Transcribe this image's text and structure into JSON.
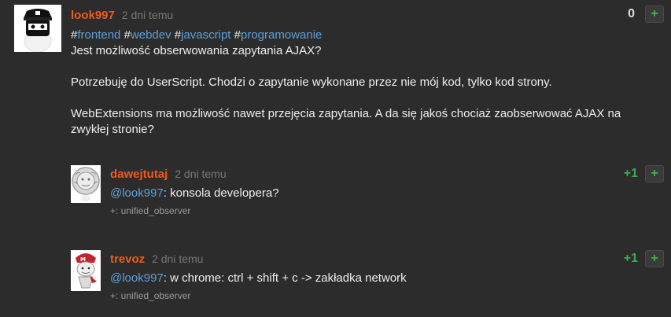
{
  "entry": {
    "author": "look997",
    "time": "2 dni temu",
    "votes": "0",
    "vote_button": "+",
    "tags": [
      {
        "hash": "#",
        "name": "frontend"
      },
      {
        "hash": "#",
        "name": "webdev"
      },
      {
        "hash": "#",
        "name": "javascript"
      },
      {
        "hash": "#",
        "name": "programowanie"
      }
    ],
    "paragraphs": [
      "Jest możliwość obserwowania zapytania AJAX?",
      "Potrzebuję do UserScript. Chodzi o zapytanie wykonane przez nie mój kod, tylko kod strony.",
      "WebExtensions ma możliwość nawet przejęcia zapytania. A da się jakoś chociaż zaobserwować AJAX na zwykłej stronie?"
    ]
  },
  "comments": [
    {
      "author": "dawejtutaj",
      "time": "2 dni temu",
      "votes": "+1",
      "vote_button": "+",
      "mention": "@look997",
      "text": ": konsola developera?",
      "meta": "+: unified_observer"
    },
    {
      "author": "trevoz",
      "time": "2 dni temu",
      "votes": "+1",
      "vote_button": "+",
      "mention": "@look997",
      "text": ": w chrome: ctrl + shift + c -> zakładka network",
      "meta": "+: unified_observer"
    }
  ],
  "colors": {
    "background": "#2c2c2c",
    "author": "#f05a1e",
    "link": "#5f9fd7",
    "vote_positive": "#3cab52"
  }
}
